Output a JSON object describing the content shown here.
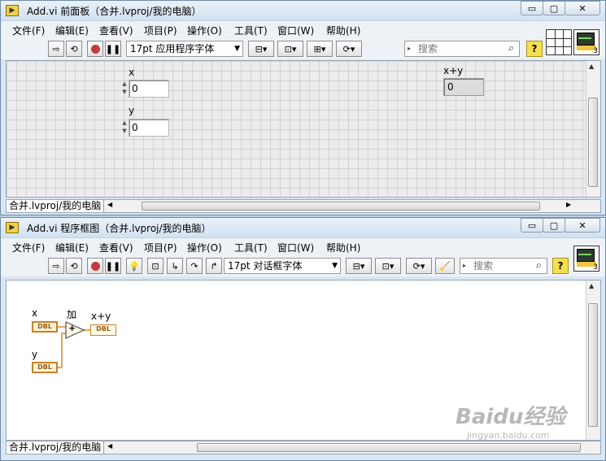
{
  "front_panel": {
    "title": "Add.vi 前面板（合并.lvproj/我的电脑）",
    "menu": [
      "文件(F)",
      "编辑(E)",
      "查看(V)",
      "项目(P)",
      "操作(O)",
      "工具(T)",
      "窗口(W)",
      "帮助(H)"
    ],
    "font_select": "17pt 应用程序字体",
    "search_placeholder": "搜索",
    "controls": [
      {
        "label": "x",
        "value": "0"
      },
      {
        "label": "y",
        "value": "0"
      }
    ],
    "indicator": {
      "label": "x+y",
      "value": "0"
    },
    "status_path": "合并.lvproj/我的电脑",
    "connector_number": "3"
  },
  "block_diagram": {
    "title": "Add.vi 程序框图（合并.lvproj/我的电脑）",
    "menu": [
      "文件(F)",
      "编辑(E)",
      "查看(V)",
      "项目(P)",
      "操作(O)",
      "工具(T)",
      "窗口(W)",
      "帮助(H)"
    ],
    "font_select": "17pt 对话框字体",
    "search_placeholder": "搜索",
    "terminals": [
      {
        "label": "x",
        "type": "DBL"
      },
      {
        "label": "y",
        "type": "DBL"
      },
      {
        "label": "x+y",
        "type": "DBL"
      }
    ],
    "add_node_label": "加",
    "add_symbol": "+",
    "status_path": "合并.lvproj/我的电脑",
    "connector_number": "3"
  },
  "window_buttons": {
    "minimize": "▭",
    "maximize": "▢",
    "close": "✕"
  },
  "watermark": {
    "brand": "Baidu经验",
    "url": "jingyan.baidu.com"
  }
}
